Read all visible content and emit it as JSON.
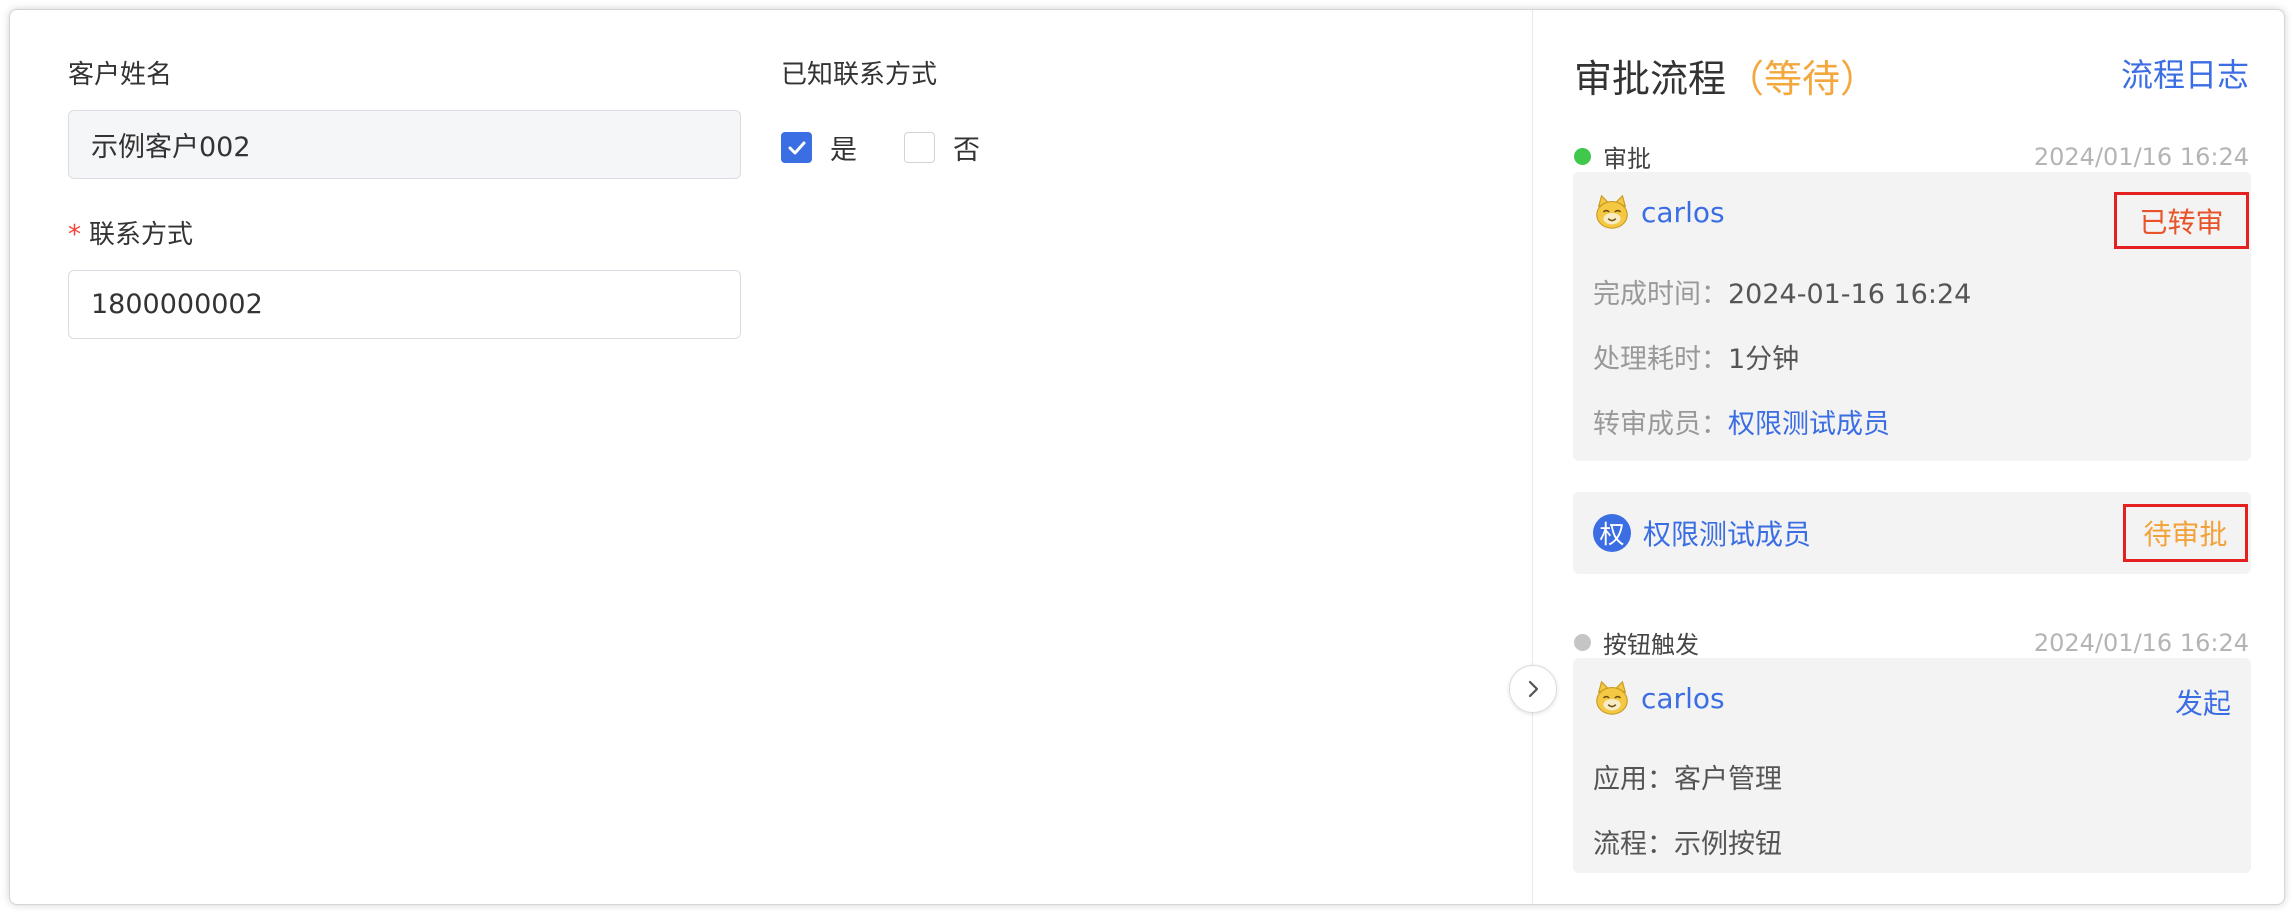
{
  "form": {
    "customer_name_label": "客户姓名",
    "customer_name_value": "示例客户002",
    "known_contact_label": "已知联系方式",
    "option_yes": "是",
    "option_no": "否",
    "yes_checked": true,
    "contact_required_mark": "*",
    "contact_label": "联系方式",
    "contact_value": "1800000002"
  },
  "panel": {
    "title": "审批流程",
    "status": "（等待）",
    "log_link": "流程日志",
    "nodes": [
      {
        "name": "审批",
        "time": "2024/01/16 16:24",
        "dot_color": "#3fc84b",
        "user": "carlos",
        "badge": "已转审",
        "fields": [
          {
            "key": "完成时间：",
            "value": "2024-01-16 16:24"
          },
          {
            "key": "处理耗时：",
            "value": "1分钟"
          },
          {
            "key": "转审成员：",
            "value": "权限测试成员"
          }
        ]
      },
      {
        "user_initial": "权",
        "user": "权限测试成员",
        "badge": "待审批"
      },
      {
        "name": "按钮触发",
        "time": "2024/01/16 16:24",
        "dot_color": "#c5c5c5",
        "user": "carlos",
        "action": "发起",
        "fields": [
          {
            "key": "应用：",
            "value": "客户管理"
          },
          {
            "key": "流程：",
            "value": "示例按钮"
          }
        ]
      }
    ]
  },
  "colors": {
    "accent": "#3b6ee3",
    "pending": "#f3a73c",
    "transferred": "#e8542a",
    "highlight_box": "#e52020"
  }
}
